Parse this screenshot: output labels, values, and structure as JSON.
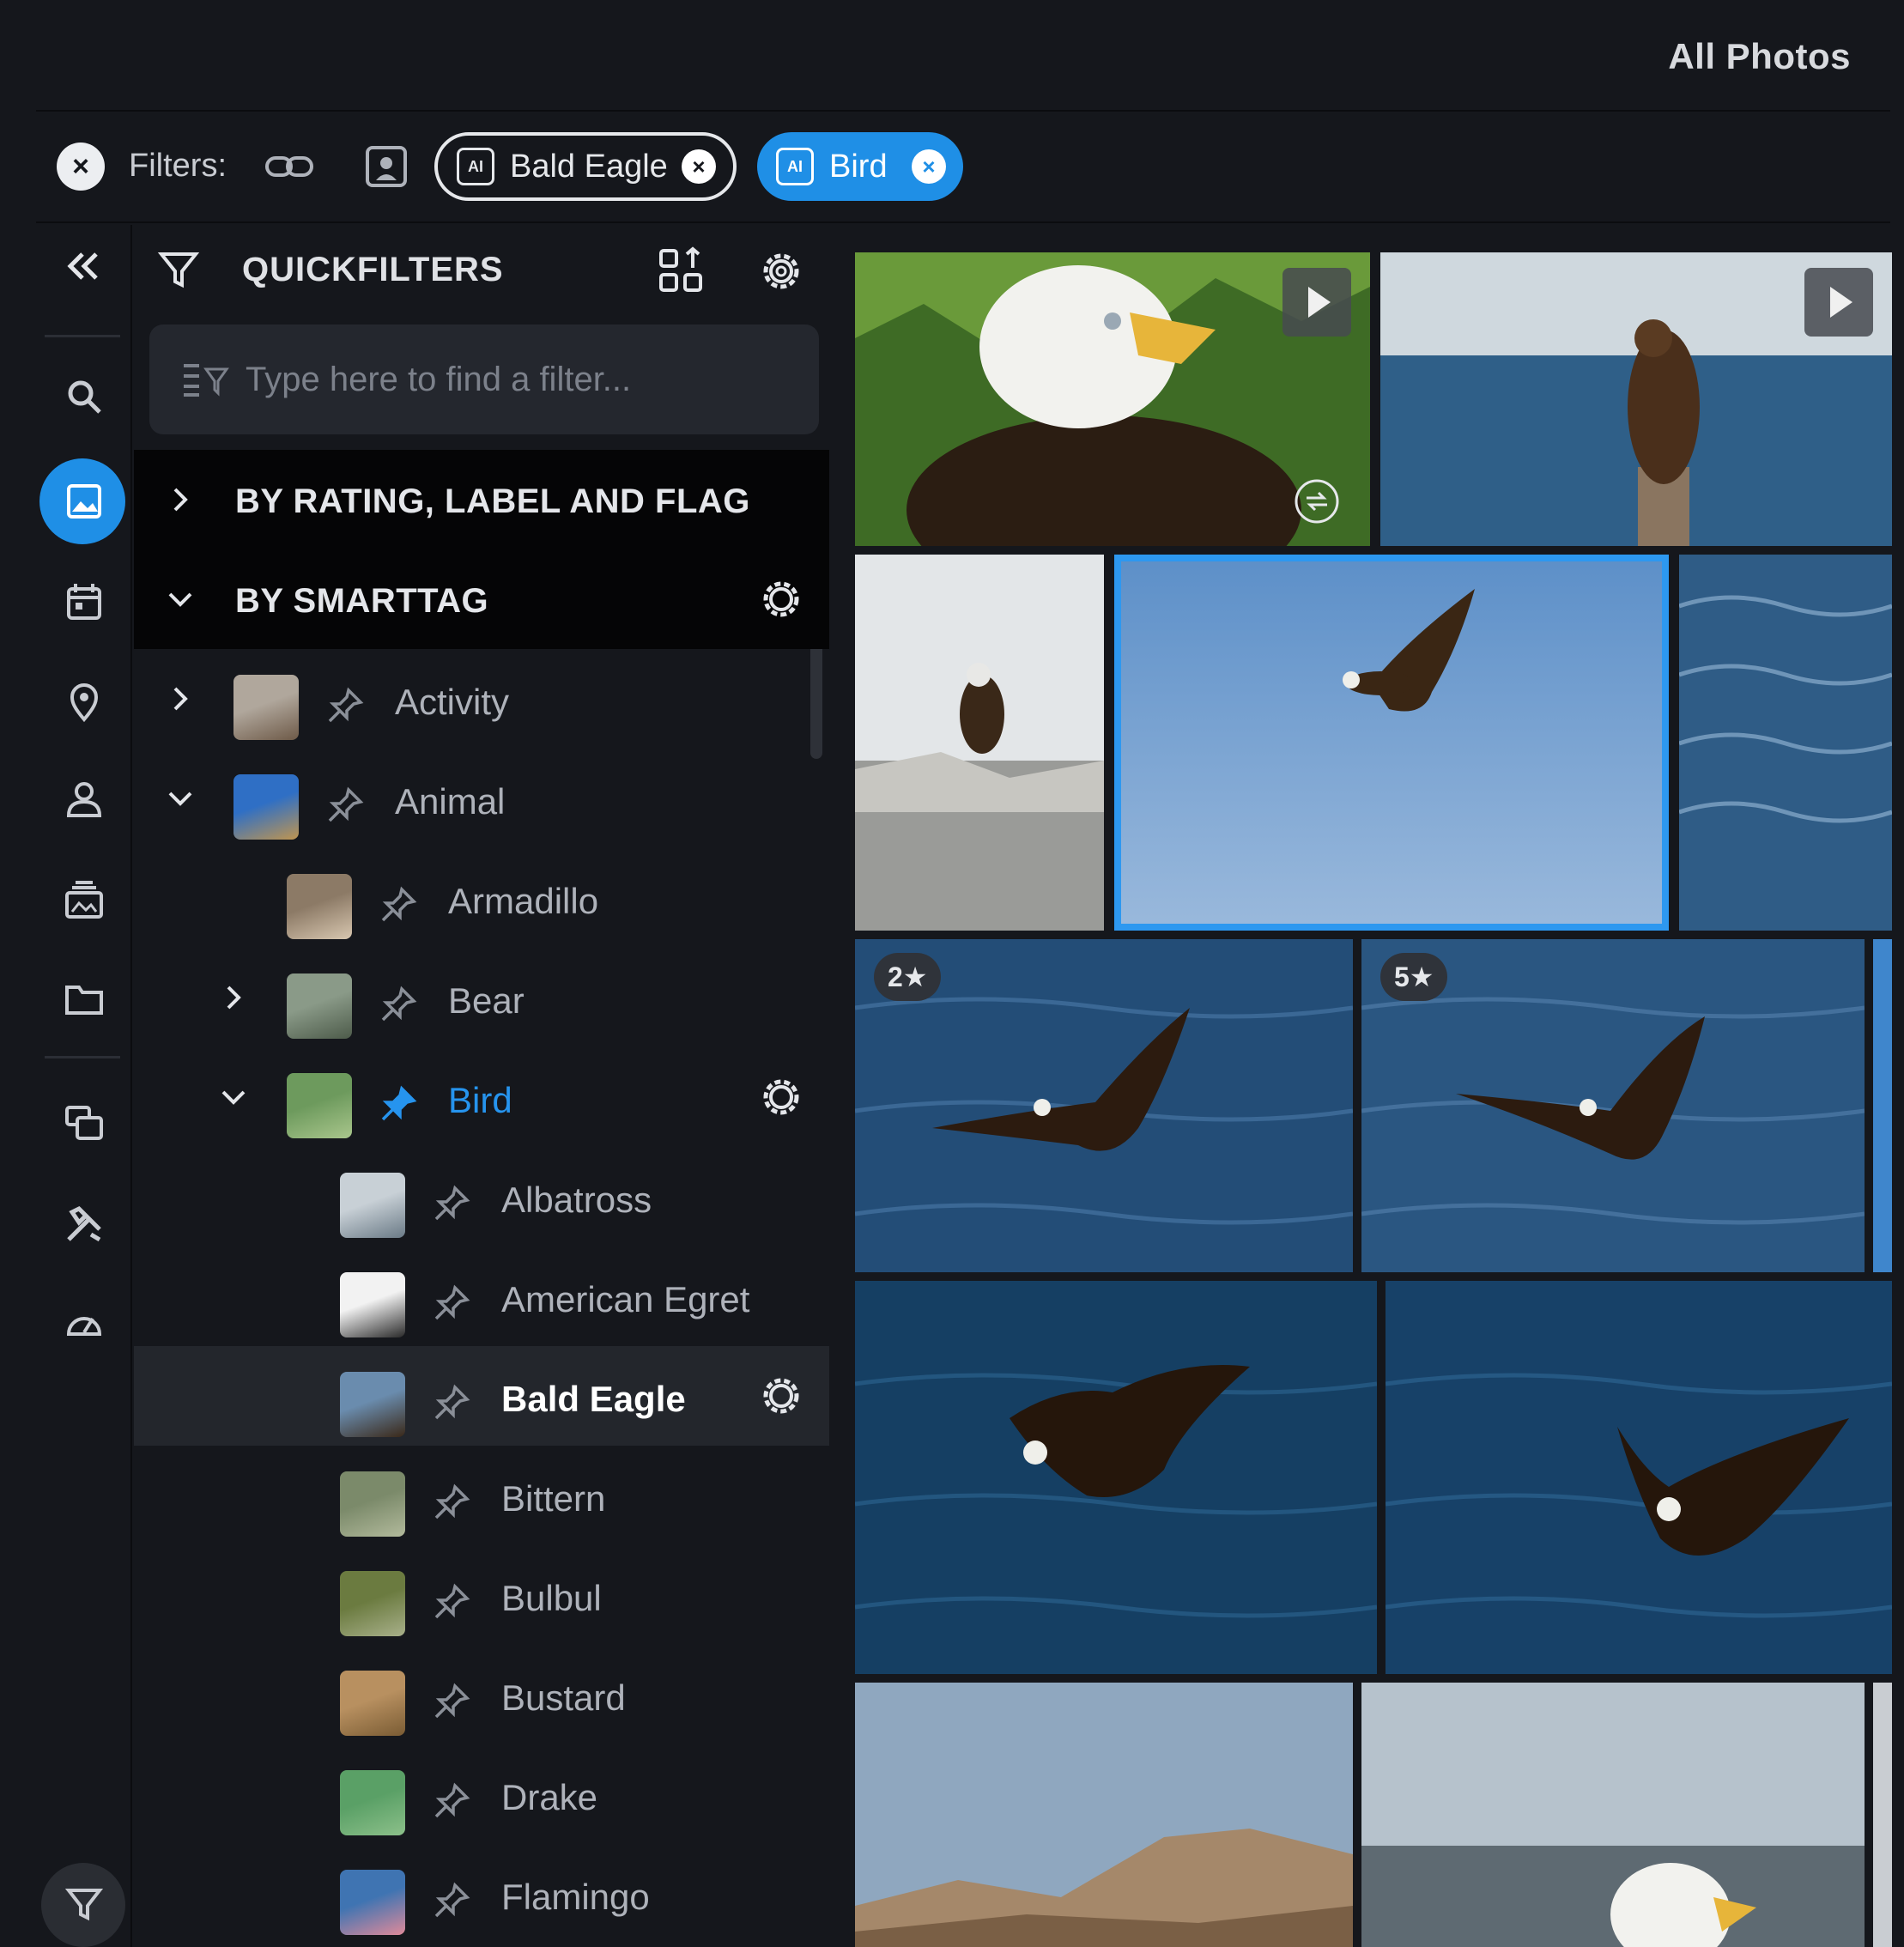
{
  "header": {
    "title": "All Photos"
  },
  "filter_bar": {
    "label": "Filters:",
    "chips": [
      {
        "label": "Bald Eagle",
        "icon": "ai-tag-icon",
        "style": "outline"
      },
      {
        "label": "Bird",
        "icon": "ai-tag-icon",
        "style": "filled"
      }
    ]
  },
  "quickfilters": {
    "title": "QUICKFILTERS",
    "search_placeholder": "Type here to find a filter...",
    "sections": [
      {
        "label": "BY RATING, LABEL AND FLAG",
        "expanded": false
      },
      {
        "label": "BY SMARTTAG",
        "expanded": true
      }
    ],
    "tags": [
      {
        "label": "Activity",
        "pinned": false,
        "expander": "collapsed"
      },
      {
        "label": "Animal",
        "pinned": false,
        "expander": "expanded"
      },
      {
        "label": "Armadillo",
        "pinned": false,
        "expander": "none"
      },
      {
        "label": "Bear",
        "pinned": false,
        "expander": "collapsed"
      },
      {
        "label": "Bird",
        "pinned": true,
        "expander": "expanded",
        "active": true
      },
      {
        "label": "Albatross",
        "pinned": false,
        "expander": "none"
      },
      {
        "label": "American Egret",
        "pinned": false,
        "expander": "none"
      },
      {
        "label": "Bald Eagle",
        "pinned": false,
        "expander": "none",
        "selected": true
      },
      {
        "label": "Bittern",
        "pinned": false,
        "expander": "none"
      },
      {
        "label": "Bulbul",
        "pinned": false,
        "expander": "none"
      },
      {
        "label": "Bustard",
        "pinned": false,
        "expander": "none"
      },
      {
        "label": "Drake",
        "pinned": false,
        "expander": "none"
      },
      {
        "label": "Flamingo",
        "pinned": false,
        "expander": "none"
      }
    ]
  },
  "gallery": {
    "badges": [
      "2★",
      "5★"
    ]
  },
  "colors": {
    "accent": "#1f8fe6",
    "background": "#15171c",
    "section_bg": "#050506"
  }
}
